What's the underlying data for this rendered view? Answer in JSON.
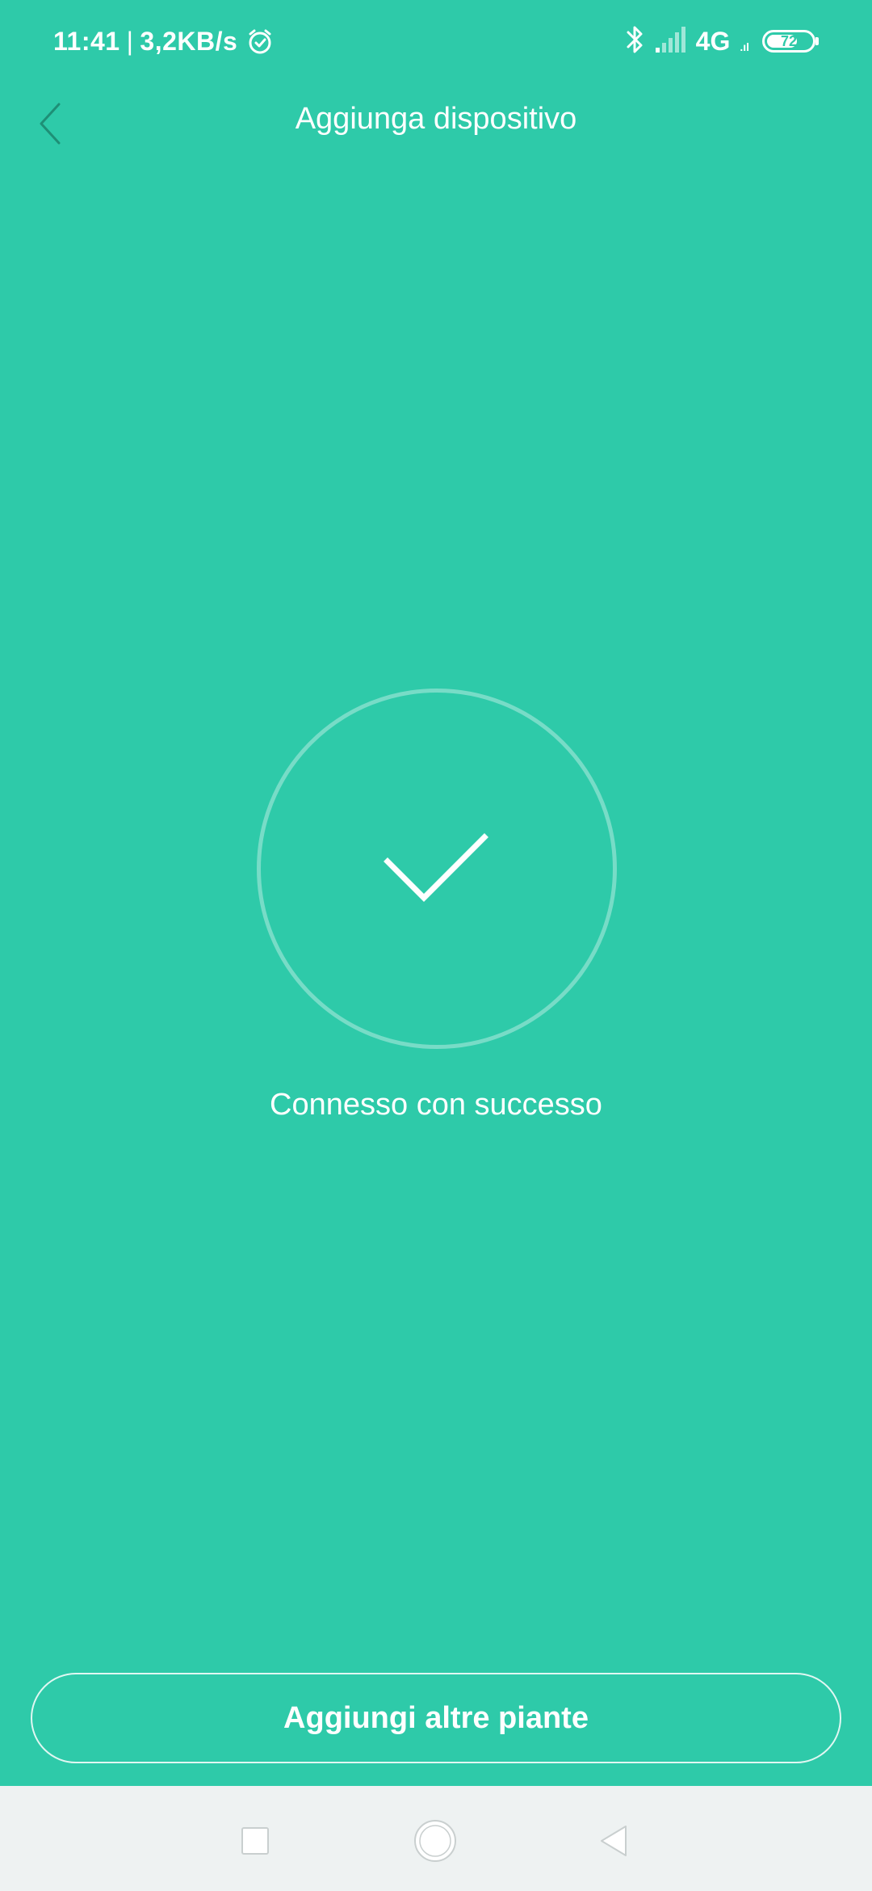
{
  "status_bar": {
    "time": "11:41",
    "separator": "|",
    "net_speed": "3,2KB/s",
    "network": "4G",
    "network_sub": ".ıl",
    "battery": "72",
    "battery_level": 0.72,
    "icons": [
      "alarm-clock-icon",
      "bluetooth-icon",
      "signal-icon",
      "battery-icon"
    ]
  },
  "header": {
    "title": "Aggiunga dispositivo",
    "back_icon": "chevron-left-icon"
  },
  "main": {
    "status_icon": "check-icon",
    "message": "Connesso con successo"
  },
  "actions": {
    "add_more_label": "Aggiungi altre piante"
  },
  "nav_bar": {
    "icons": [
      "square-recents-icon",
      "circle-home-icon",
      "triangle-back-icon"
    ]
  },
  "colors": {
    "background": "#2ECAA9",
    "nav_bar": "#EEF2F2",
    "text": "#FFFFFF"
  }
}
